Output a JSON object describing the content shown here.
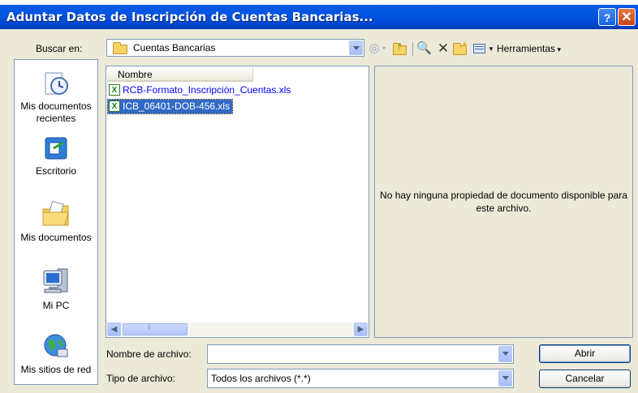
{
  "window": {
    "title": "Aduntar Datos de Inscripción de Cuentas Bancarias...",
    "help_label": "?",
    "close_label": "✕"
  },
  "toolbar": {
    "look_in_label": "Buscar en:",
    "look_in_value": "Cuentas Bancarias",
    "tools_label": "Herramientas"
  },
  "places": [
    {
      "label": "Mis documentos recientes",
      "icon": "recent-documents-icon"
    },
    {
      "label": "Escritorio",
      "icon": "desktop-icon"
    },
    {
      "label": "Mis documentos",
      "icon": "my-documents-icon"
    },
    {
      "label": "Mi PC",
      "icon": "my-computer-icon"
    },
    {
      "label": "Mis sitios de red",
      "icon": "network-places-icon"
    }
  ],
  "file_list": {
    "column_header": "Nombre",
    "files": [
      {
        "name": "RCB-Formato_Inscripción_Cuentas.xls",
        "icon": "excel-file-icon"
      },
      {
        "name": "ICB_06401-DOB-456.xls",
        "icon": "excel-file-icon",
        "selected": true
      }
    ]
  },
  "preview": {
    "message": "No hay ninguna propiedad de documento disponible para este archivo."
  },
  "form": {
    "filename_label": "Nombre de archivo:",
    "filename_value": "",
    "filetype_label": "Tipo de archivo:",
    "filetype_value": "Todos los archivos (*.*)",
    "open_label": "Abrir",
    "cancel_label": "Cancelar"
  },
  "colors": {
    "titlebar": "#0054e3",
    "dialog_bg": "#ece9d8",
    "selection": "#316ac5",
    "link_text": "#0000ff"
  }
}
